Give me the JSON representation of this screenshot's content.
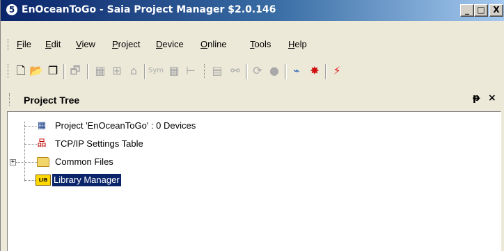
{
  "window": {
    "title": "EnOceanToGo - Saia Project Manager $2.0.146",
    "app_icon": "5",
    "controls": {
      "minimize": "_",
      "maximize": "□",
      "close": "X"
    }
  },
  "menu": {
    "items": [
      {
        "label": "File",
        "accel": "F"
      },
      {
        "label": "Edit",
        "accel": "E"
      },
      {
        "label": "View",
        "accel": "V"
      },
      {
        "label": "Project",
        "accel": "P"
      },
      {
        "label": "Device",
        "accel": "D"
      },
      {
        "label": "Online",
        "accel": "O"
      },
      {
        "label": "Tools",
        "accel": "T"
      },
      {
        "label": "Help",
        "accel": "H"
      }
    ]
  },
  "toolbar": {
    "buttons": [
      {
        "icon": "new-file-icon",
        "glyph": "🗋"
      },
      {
        "icon": "open-folder-icon",
        "glyph": "📂"
      },
      {
        "icon": "copy-icon",
        "glyph": "❐"
      },
      {
        "icon": "properties-icon",
        "glyph": "🗗"
      },
      {
        "icon": "device-icon",
        "glyph": "▦"
      },
      {
        "icon": "device-network-icon",
        "glyph": "⊞"
      },
      {
        "icon": "device-clean-icon",
        "glyph": "⌂"
      },
      {
        "icon": "symbol-editor-icon",
        "glyph": "Σ",
        "text": "Sym"
      },
      {
        "icon": "table-icon",
        "glyph": "▦"
      },
      {
        "icon": "tree-view-icon",
        "glyph": "⊢"
      },
      {
        "icon": "online-configurator-icon",
        "glyph": "▤"
      },
      {
        "icon": "watch-window-icon",
        "glyph": "⚯"
      },
      {
        "icon": "restart-icon",
        "glyph": "⟳"
      },
      {
        "icon": "stop-icon",
        "glyph": "●"
      },
      {
        "icon": "online-debug-icon",
        "glyph": "⌁"
      },
      {
        "icon": "debugger-bug-icon",
        "glyph": "✸"
      },
      {
        "icon": "graph-icon",
        "glyph": "⚡"
      }
    ]
  },
  "panel": {
    "title": "Project Tree",
    "pin": "ᵽ",
    "close": "×"
  },
  "tree": {
    "items": [
      {
        "label": "Project 'EnOceanToGo' : 0 Devices",
        "icon": "project-icon",
        "glyph": "▦"
      },
      {
        "label": "TCP/IP Settings Table",
        "icon": "network-icon",
        "glyph": "品"
      },
      {
        "label": "Common Files",
        "icon": "folder-icon",
        "glyph": "",
        "expander": "+"
      },
      {
        "label": "Library Manager",
        "icon": "library-icon",
        "glyph": "LIB",
        "selected": true
      }
    ]
  },
  "colors": {
    "title_gradient_start": "#0a246a",
    "title_gradient_end": "#a6caf0",
    "selection": "#0a246a",
    "chrome": "#ece9d8"
  }
}
